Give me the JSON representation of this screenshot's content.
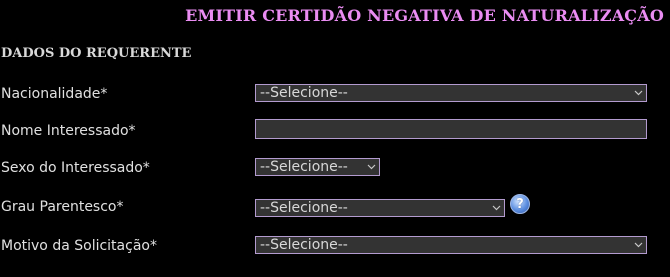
{
  "header": {
    "title": "EMITIR CERTIDÃO NEGATIVA DE NATURALIZAÇÃO",
    "title_color": "#ea8cf2"
  },
  "section": {
    "title": "DADOS DO REQUERENTE"
  },
  "form": {
    "nacionalidade": {
      "label": "Nacionalidade*",
      "selected": "--Selecione--"
    },
    "nome_interessado": {
      "label": "Nome Interessado*",
      "value": ""
    },
    "sexo": {
      "label": "Sexo do Interessado*",
      "selected": "--Selecione--"
    },
    "grau_parentesco": {
      "label": "Grau Parentesco*",
      "selected": "--Selecione--",
      "help_glyph": "?"
    },
    "motivo": {
      "label": "Motivo da Solicitação*",
      "selected": "--Selecione--"
    }
  },
  "icons": {
    "dropdown": "chevron-down-icon",
    "help": "help-icon"
  },
  "colors": {
    "background": "#000000",
    "field_background": "#333333",
    "field_border": "#b39bcf"
  }
}
